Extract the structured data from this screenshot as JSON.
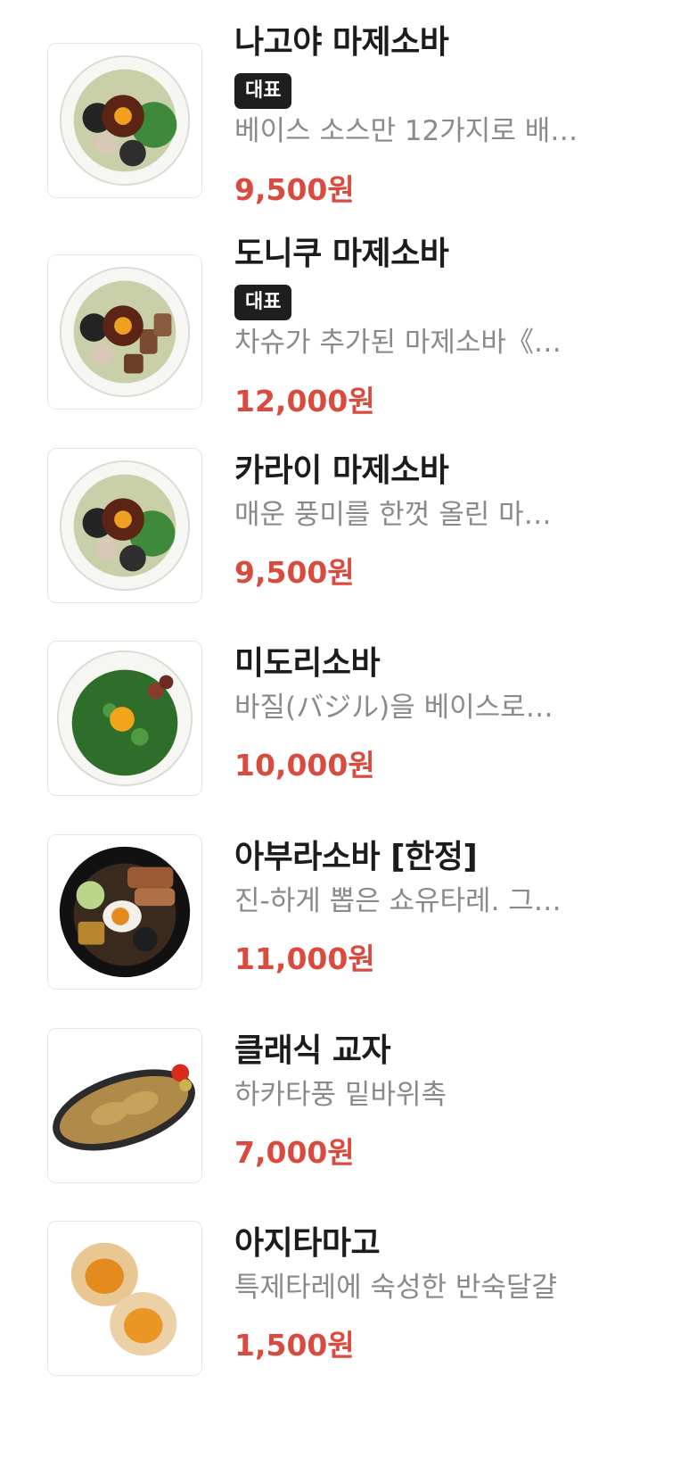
{
  "menu": {
    "items": [
      {
        "name": "나고야 마제소바",
        "badge": "대표",
        "desc": "베이스 소스만 12가지로 배…",
        "price": "9,500원",
        "image": "mazesoba-bowl"
      },
      {
        "name": "도니쿠 마제소바",
        "badge": "대표",
        "desc": "차슈가 추가된 마제소바《…",
        "price": "12,000원",
        "image": "mazesoba-chashu-bowl"
      },
      {
        "name": "카라이 마제소바",
        "desc": "매운 풍미를 한껏 올린 마…",
        "price": "9,500원",
        "image": "mazesoba-bowl"
      },
      {
        "name": "미도리소바",
        "desc": "바질(バジル)을 베이스로…",
        "price": "10,000원",
        "image": "basil-soba-bowl"
      },
      {
        "name": "아부라소바 [한정]",
        "desc": "진-하게 뽑은 쇼유타레. 그…",
        "price": "11,000원",
        "image": "abura-soba-bowl"
      },
      {
        "name": "클래식 교자",
        "desc": "하카타풍 밑바위촉",
        "price": "7,000원",
        "image": "gyoza-plate"
      },
      {
        "name": "아지타마고",
        "desc": "특제타레에 숙성한 반숙달걀",
        "price": "1,500원",
        "image": "ajitama-eggs"
      }
    ]
  },
  "colors": {
    "price": "#d94b3e",
    "badge_bg": "#1e1e1e",
    "name": "#1c1c1c",
    "desc": "#8a8a8a"
  }
}
